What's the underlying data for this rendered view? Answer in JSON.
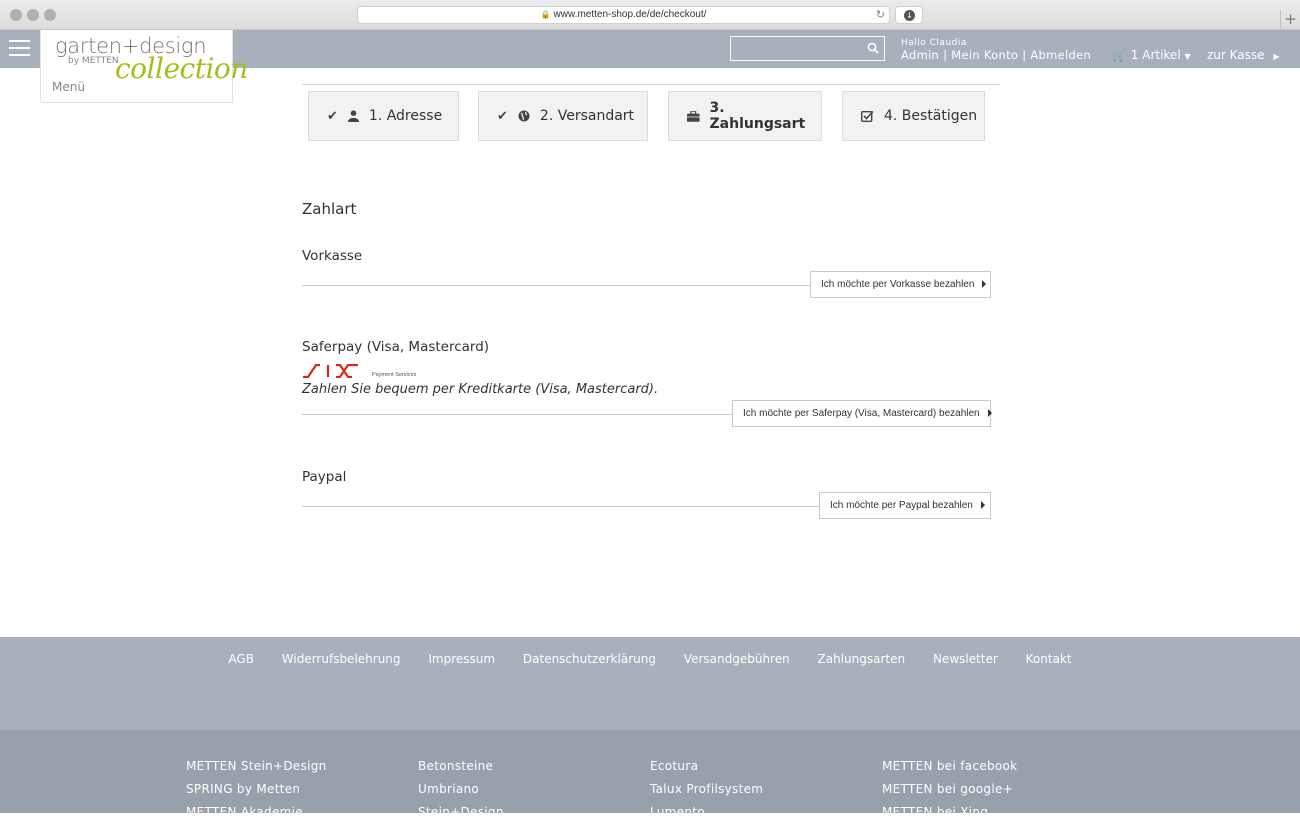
{
  "browser": {
    "url": "www.metten-shop.de/de/checkout/"
  },
  "header": {
    "greeting": "Hallo Claudia",
    "account_links": [
      "Admin",
      "Mein Konto",
      "Abmelden"
    ],
    "cart_label": "1 Artikel",
    "checkout_label": "zur Kasse",
    "search_placeholder": ""
  },
  "logo": {
    "main": "garten+design",
    "sub": "by METTEN",
    "script": "collection",
    "menu_label": "Menü"
  },
  "steps": [
    {
      "label": "1. Adresse",
      "icon": "user-icon",
      "done": true
    },
    {
      "label": "2. Versandart",
      "icon": "globe-icon",
      "done": true
    },
    {
      "label": "3. Zahlungsart",
      "icon": "briefcase-icon",
      "done": false,
      "active": true
    },
    {
      "label": "4. Bestätigen",
      "icon": "checkbox-icon",
      "done": false
    }
  ],
  "payment": {
    "title": "Zahlart",
    "methods": [
      {
        "name": "Vorkasse",
        "button": "Ich möchte per Vorkasse bezahlen"
      },
      {
        "name": "Saferpay (Visa, Mastercard)",
        "logo_sub": "Payment Services",
        "description": "Zahlen Sie bequem per Kreditkarte (Visa, Mastercard).",
        "button": "Ich möchte per Saferpay (Visa, Mastercard) bezahlen"
      },
      {
        "name": "Paypal",
        "button": "Ich möchte per Paypal bezahlen"
      }
    ]
  },
  "footer": {
    "links": [
      "AGB",
      "Widerrufsbelehrung",
      "Impressum",
      "Datenschutzerklärung",
      "Versandgebühren",
      "Zahlungsarten",
      "Newsletter",
      "Kontakt"
    ],
    "columns": [
      [
        "METTEN Stein+Design",
        "SPRING by Metten",
        "METTEN Akademie"
      ],
      [
        "Betonsteine",
        "Umbriano",
        "Stein+Design"
      ],
      [
        "Ecotura",
        "Talux Profilsystem",
        "Lumento"
      ],
      [
        "METTEN bei facebook",
        "METTEN bei google+",
        "METTEN bei Xing"
      ]
    ]
  },
  "colors": {
    "header_bg": "#a8b1bb",
    "footer_bottom_bg": "#98a1ab",
    "logo_green": "#9ec11e",
    "six_red": "#d9261c"
  }
}
